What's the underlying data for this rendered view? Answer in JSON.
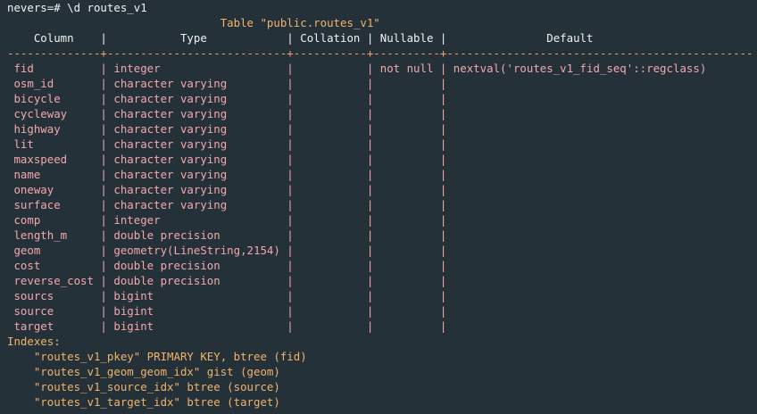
{
  "terminal": {
    "prompt": "nevers=# \\d routes_v1",
    "table_title": "                                Table \"public.routes_v1\"",
    "header": "    Column    |           Type            | Collation | Nullable |               Default",
    "separator": "--------------+---------------------------+-----------+----------+----------------------------------------------",
    "rows": [
      " fid          | integer                   |           | not null | nextval('routes_v1_fid_seq'::regclass)",
      " osm_id       | character varying         |           |          |",
      " bicycle      | character varying         |           |          |",
      " cycleway     | character varying         |           |          |",
      " highway      | character varying         |           |          |",
      " lit          | character varying         |           |          |",
      " maxspeed     | character varying         |           |          |",
      " name         | character varying         |           |          |",
      " oneway       | character varying         |           |          |",
      " surface      | character varying         |           |          |",
      " comp         | integer                   |           |          |",
      " length_m     | double precision          |           |          |",
      " geom         | geometry(LineString,2154) |           |          |",
      " cost         | double precision          |           |          |",
      " reverse_cost | double precision          |           |          |",
      " sourcs       | bigint                    |           |          |",
      " source       | bigint                    |           |          |",
      " target       | bigint                    |           |          |"
    ],
    "indexes_label": "Indexes:",
    "indexes": [
      "    \"routes_v1_pkey\" PRIMARY KEY, btree (fid)",
      "    \"routes_v1_geom_geom_idx\" gist (geom)",
      "    \"routes_v1_source_idx\" btree (source)",
      "    \"routes_v1_target_idx\" btree (target)"
    ]
  }
}
